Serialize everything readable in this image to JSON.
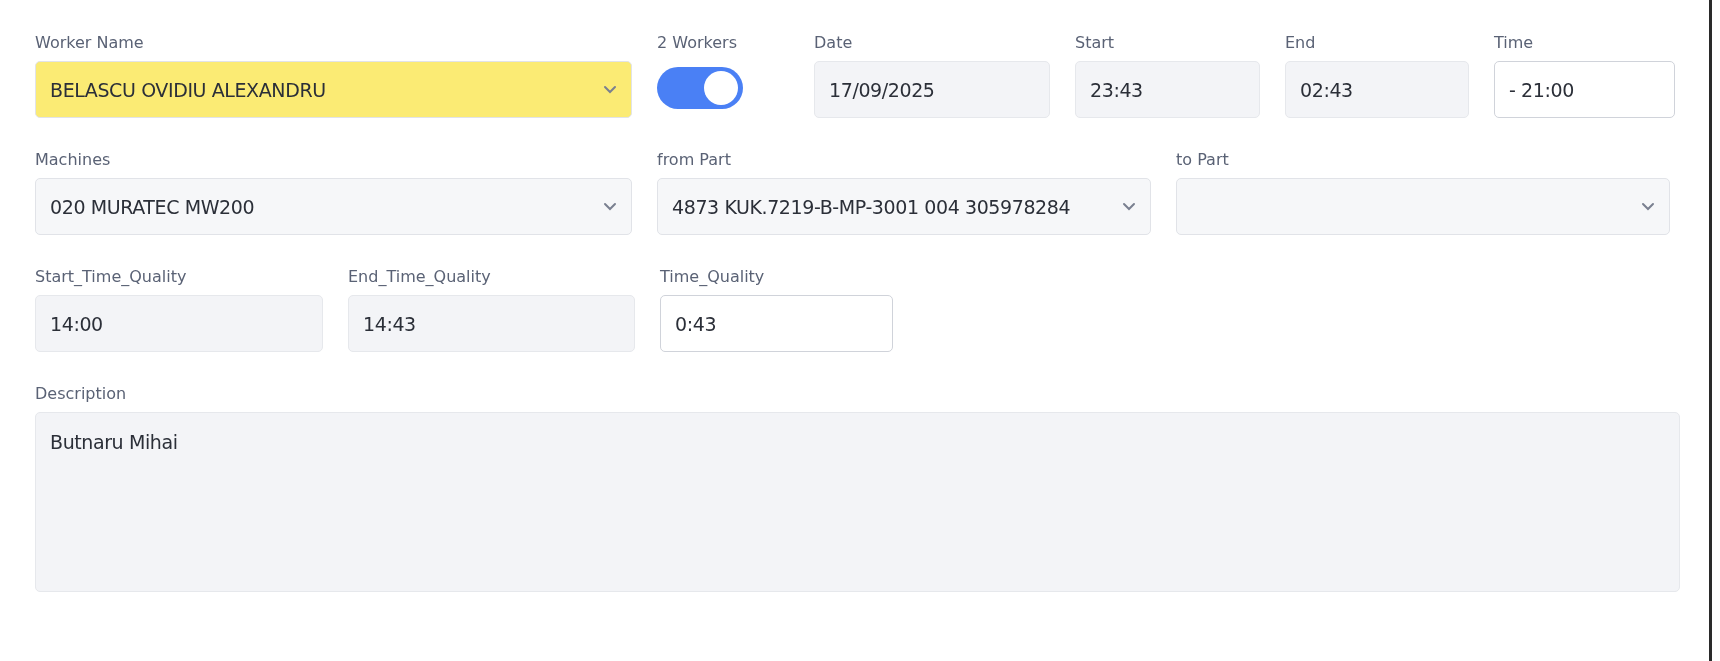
{
  "rows": [
    {
      "fields": [
        {
          "kind": "select",
          "label": "Worker Name",
          "value": "BELASCU OVIDIU ALEXANDRU",
          "highlighted": true
        },
        {
          "kind": "toggle",
          "label": "2 Workers",
          "on": true
        },
        {
          "kind": "text",
          "label": "Date",
          "value": "17/09/2025",
          "readonly": true
        },
        {
          "kind": "text",
          "label": "Start",
          "value": "23:43",
          "readonly": true
        },
        {
          "kind": "text",
          "label": "End",
          "value": "02:43",
          "readonly": true
        },
        {
          "kind": "text",
          "label": "Time",
          "value": "- 21:00",
          "readonly": false
        }
      ]
    },
    {
      "fields": [
        {
          "kind": "select",
          "label": "Machines",
          "value": "020 MURATEC MW200",
          "highlighted": false
        },
        {
          "kind": "select",
          "label": "from Part",
          "value": "4873 KUK.7219-B-MP-3001 004 305978284",
          "highlighted": false
        },
        {
          "kind": "select",
          "label": "to Part",
          "highlighted": false
        }
      ]
    },
    {
      "fields": [
        {
          "kind": "text",
          "label": "Start_Time_Quality",
          "value": "14:00",
          "readonly": true
        },
        {
          "kind": "text",
          "label": "End_Time_Quality",
          "value": "14:43",
          "readonly": true
        },
        {
          "kind": "text",
          "label": "Time_Quality",
          "value": "0:43",
          "readonly": false
        }
      ]
    },
    {
      "fields": [
        {
          "kind": "textarea",
          "label": "Description",
          "value": "Butnaru Mihai",
          "readonly": true
        }
      ]
    }
  ]
}
